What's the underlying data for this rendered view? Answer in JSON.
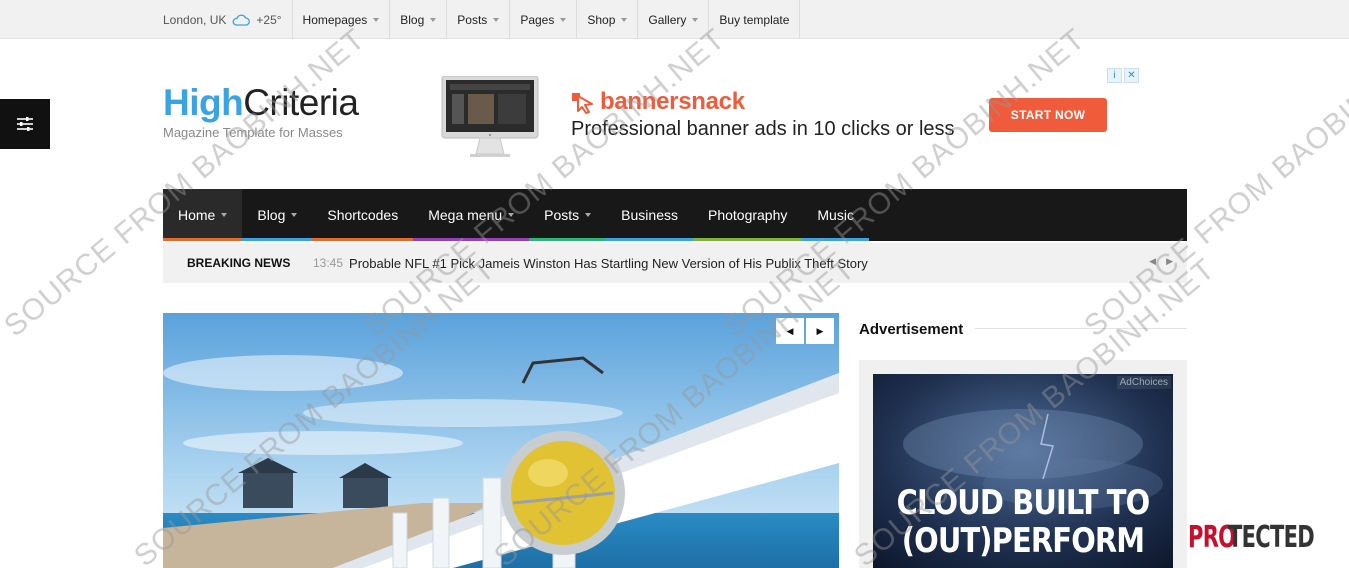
{
  "topbar": {
    "location": "London, UK",
    "temperature": "+25°",
    "items": [
      {
        "label": "Homepages",
        "dropdown": true
      },
      {
        "label": "Blog",
        "dropdown": true
      },
      {
        "label": "Posts",
        "dropdown": true
      },
      {
        "label": "Pages",
        "dropdown": true
      },
      {
        "label": "Shop",
        "dropdown": true
      },
      {
        "label": "Gallery",
        "dropdown": true
      },
      {
        "label": "Buy template",
        "dropdown": false
      }
    ]
  },
  "logo": {
    "part1": "High",
    "part2": "Criteria",
    "tagline": "Magazine Template for Masses"
  },
  "banner_ad": {
    "brand": "bannersnack",
    "headline": "Professional banner ads in 10 clicks or less",
    "cta": "START NOW",
    "brand_color": "#ef5b3b"
  },
  "mainnav": {
    "items": [
      {
        "label": "Home",
        "dropdown": true,
        "color": "#e8692c",
        "active": true
      },
      {
        "label": "Blog",
        "dropdown": true,
        "color": "#3aa3e3"
      },
      {
        "label": "Shortcodes",
        "dropdown": false,
        "color": "#e8692c"
      },
      {
        "label": "Mega menu",
        "dropdown": true,
        "color": "#9b3dbf"
      },
      {
        "label": "Posts",
        "dropdown": true,
        "color": "#2bb673"
      },
      {
        "label": "Business",
        "dropdown": false,
        "color": "#3aa3e3"
      },
      {
        "label": "Photography",
        "dropdown": false,
        "color": "#7ab43a"
      },
      {
        "label": "Music",
        "dropdown": false,
        "color": "#3aa3e3"
      }
    ]
  },
  "breaking": {
    "label": "BREAKING NEWS",
    "time": "13:45",
    "headline": "Probable NFL #1 Pick Jameis Winston Has Startling New Version of His Publix Theft Story"
  },
  "sidebar": {
    "title": "Advertisement",
    "ad": {
      "adchoices": "AdChoices",
      "text_line1": "CLOUD BUILT TO",
      "text_line2": "(OUT)PERFORM"
    }
  },
  "badge": {
    "part1": "PRO",
    "part2": "TECTED"
  },
  "watermark": "SOURCE FROM BAOBINH.NET",
  "icons": {
    "weather": "cloud-icon",
    "side_toggle": "sliders-icon",
    "prev": "chevron-left-icon",
    "next": "chevron-right-icon"
  }
}
